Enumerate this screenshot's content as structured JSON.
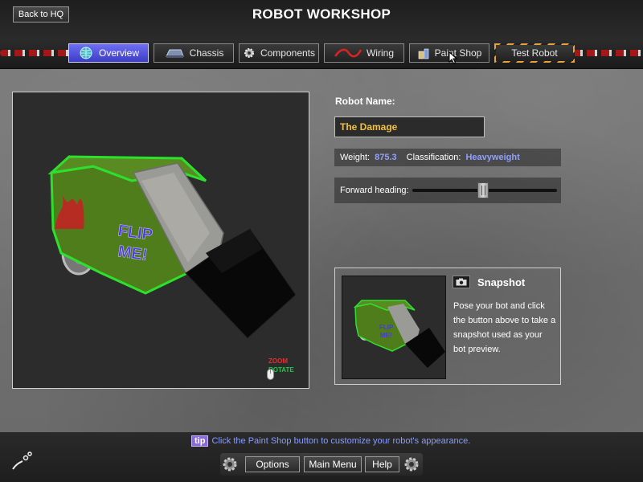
{
  "header": {
    "back_label": "Back to HQ",
    "title": "ROBOT WORKSHOP"
  },
  "tabs": [
    {
      "label": "Overview",
      "icon": "globe-icon",
      "active": true
    },
    {
      "label": "Chassis",
      "icon": "chassis-icon",
      "active": false
    },
    {
      "label": "Components",
      "icon": "gear-icon",
      "active": false
    },
    {
      "label": "Wiring",
      "icon": "wire-icon",
      "active": false
    },
    {
      "label": "Paint Shop",
      "icon": "paint-can-icon",
      "active": false
    },
    {
      "label": "Test Robot",
      "icon": "",
      "active": false
    }
  ],
  "viewport": {
    "robot_decal": "FLIP ME!",
    "hint_zoom": "ZOOM",
    "hint_rotate": "ROTATE"
  },
  "robot": {
    "name_label": "Robot Name:",
    "name_value": "The Damage",
    "weight_label": "Weight:",
    "weight_value": "875.3",
    "class_label": "Classification:",
    "class_value": "Heavyweight",
    "heading_label": "Forward heading:",
    "heading_fraction": 0.49
  },
  "snapshot": {
    "title": "Snapshot",
    "description": "Pose your bot and click the button above to take a snapshot used as your bot preview."
  },
  "footer": {
    "tip_badge": "tip",
    "tip_text": "Click the Paint Shop button to customize your robot's appearance.",
    "options_label": "Options",
    "main_menu_label": "Main Menu",
    "help_label": "Help"
  },
  "colors": {
    "accent_blue": "#8fa0ff",
    "name_gold": "#f0c040",
    "active_tab": "#5454e0",
    "robot_green": "#4f7d1c"
  }
}
